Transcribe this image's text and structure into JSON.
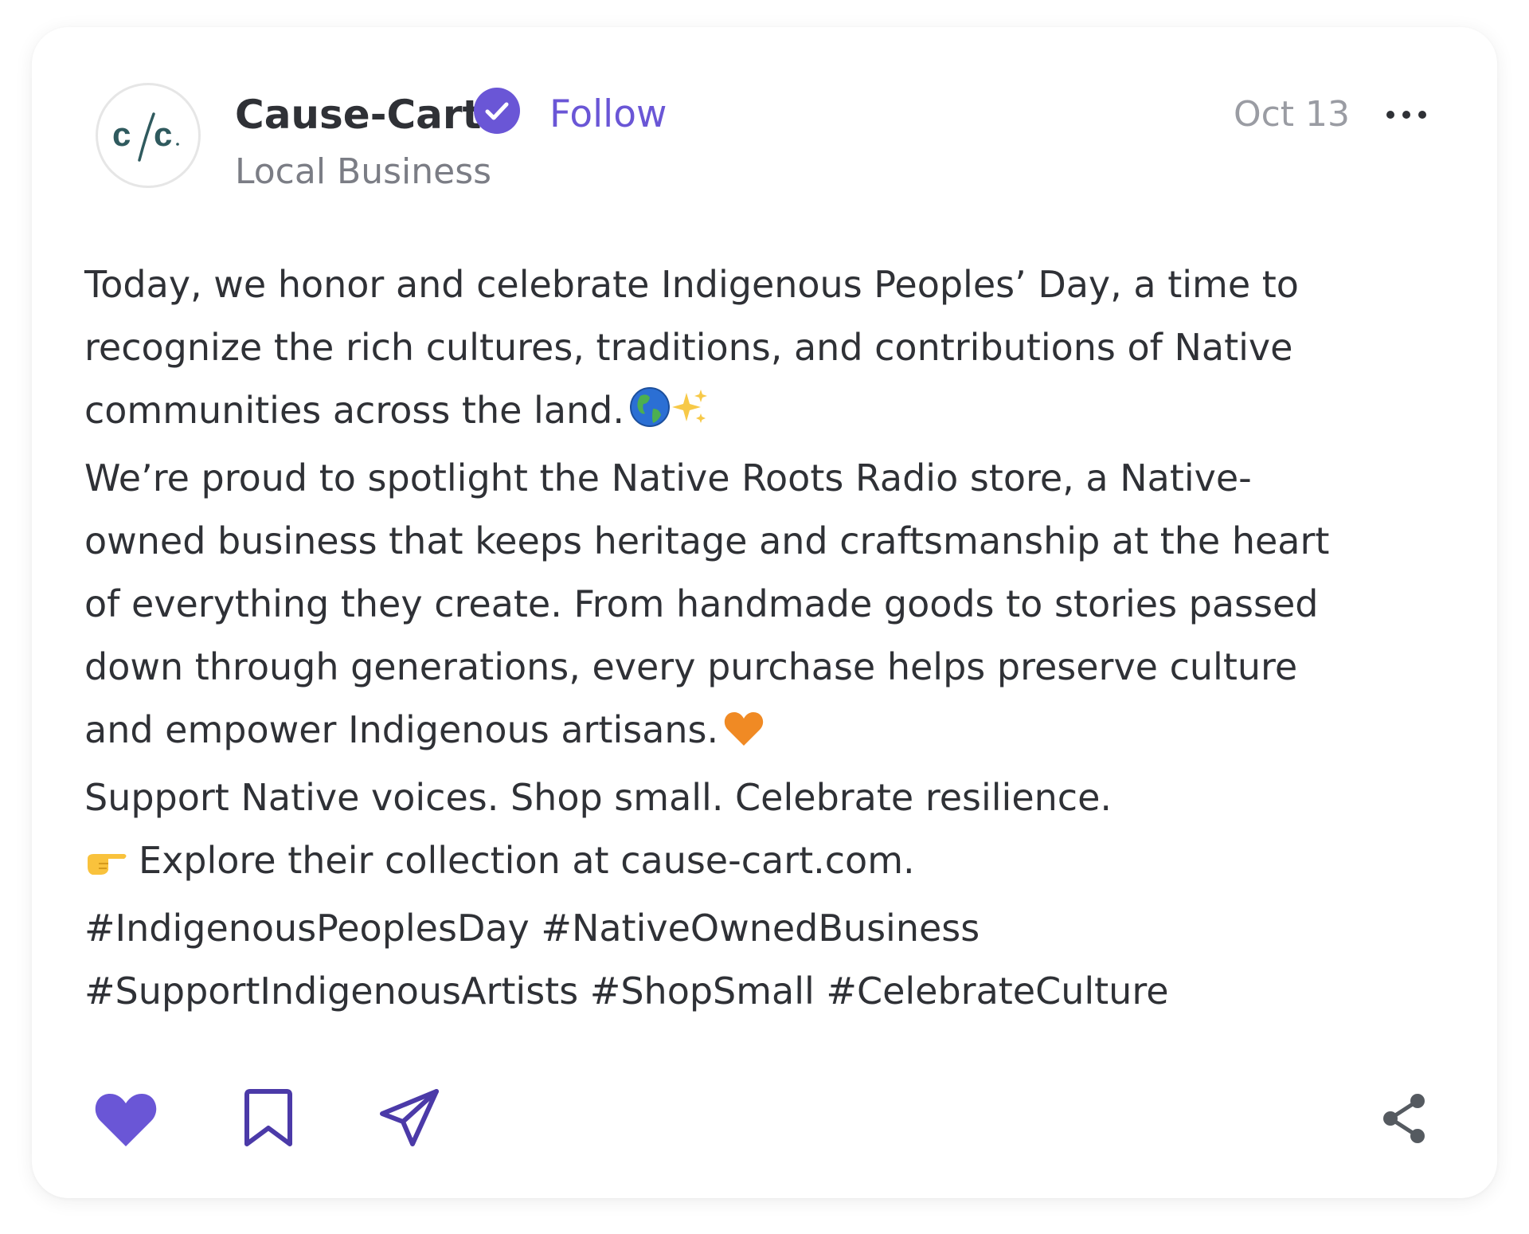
{
  "post": {
    "author": {
      "name": "Cause-Cart",
      "category": "Local Business",
      "avatar_logo_text": "c/c",
      "verified": true
    },
    "follow_label": "Follow",
    "date": "Oct 13",
    "body": [
      "Today, we honor and celebrate Indigenous Peoples’ Day, a time to",
      "recognize the rich cultures, traditions, and contributions of Native",
      "communities across the land.",
      "We’re proud to spotlight the Native Roots Radio store, a Native-",
      "owned business that keeps heritage and craftsmanship at the heart",
      "of everything they create. From handmade goods to stories passed",
      "down through generations, every purchase helps preserve culture",
      "and empower Indigenous artisans.",
      "Support Native voices. Shop small. Celebrate resilience.",
      "Explore their collection at cause-cart.com.",
      "#IndigenousPeoplesDay #NativeOwnedBusiness",
      "#SupportIndigenousArtists #ShopSmall #CelebrateCulture"
    ],
    "emojis": {
      "line3": [
        "globe-americas-emoji",
        "sparkles-emoji"
      ],
      "line8": [
        "orange-heart-emoji"
      ],
      "line10_prefix": "pointing-right-emoji"
    }
  },
  "actions": {
    "like_icon": "heart-icon",
    "bookmark_icon": "bookmark-icon",
    "send_icon": "paper-plane-icon",
    "share_icon": "share-icon",
    "liked": true
  },
  "colors": {
    "accent": "#6a56d6",
    "text": "#2f3136",
    "muted": "#7b7d85",
    "logo": "#2f5a5e"
  }
}
